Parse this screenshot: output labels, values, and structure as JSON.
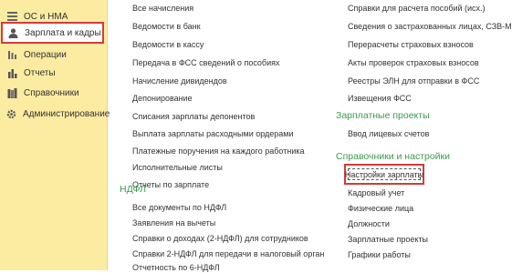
{
  "sidebar": {
    "items": [
      {
        "label": "ОС и НМА",
        "icon": "bars-icon"
      },
      {
        "label": "Зарплата и кадры",
        "icon": "person-icon"
      },
      {
        "label": "Операции",
        "icon": "tools-icon"
      },
      {
        "label": "Отчеты",
        "icon": "chart-icon"
      },
      {
        "label": "Справочники",
        "icon": "books-icon"
      },
      {
        "label": "Администрирование",
        "icon": "gear-icon"
      }
    ]
  },
  "col1": {
    "links": [
      "Все начисления",
      "Ведомости в банк",
      "Ведомости в кассу",
      "Передача в ФСС сведений о пособиях",
      "Начисление дивидендов",
      "Депонирование",
      "Списания зарплаты депонентов",
      "Выплата зарплаты расходными ордерами",
      "Платежные поручения на каждого работника",
      "Исполнительные листы",
      "Отчеты по зарплате"
    ],
    "ndfl_title": "НДФЛ",
    "ndfl_links": [
      "Все документы по НДФЛ",
      "Заявления на вычеты",
      "Справки о доходах (2-НДФЛ) для сотрудников",
      "Справки 2-НДФЛ для передачи в налоговый орган",
      "Отчетность по 6-НДФЛ"
    ]
  },
  "col2": {
    "links": [
      "Справки для расчета пособий (исх.)",
      "Сведения о застрахованных лицах, СЗВ-М",
      "Перерасчеты страховых взносов",
      "Акты проверок страховых взносов",
      "Реестры ЭЛН для отправки в ФСС",
      "Извещения ФСС"
    ],
    "projects_title": "Зарплатные проекты",
    "projects_links": [
      "Ввод лицевых счетов"
    ],
    "refs_title": "Справочники и настройки",
    "settings_link": "Настройки зарплаты",
    "refs_links": [
      "Кадровый учет",
      "Физические лица",
      "Должности",
      "Зарплатные проекты",
      "Графики работы"
    ]
  }
}
